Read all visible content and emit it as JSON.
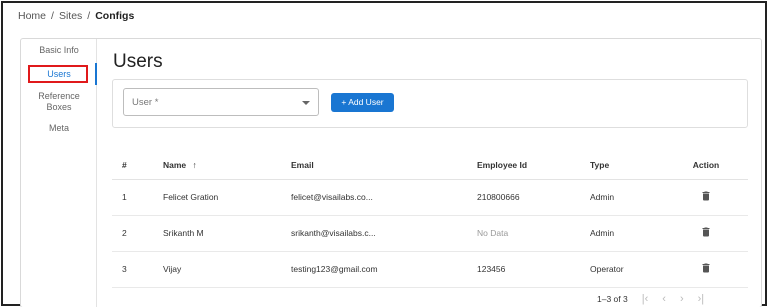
{
  "breadcrumb": {
    "items": [
      "Home",
      "Sites",
      "Configs"
    ],
    "separator": "/"
  },
  "sidebar": {
    "items": [
      {
        "label": "Basic Info"
      },
      {
        "label": "Users",
        "active": true
      },
      {
        "label": "Reference Boxes"
      },
      {
        "label": "Meta"
      }
    ]
  },
  "main": {
    "title": "Users",
    "user_select": {
      "placeholder": "User *"
    },
    "add_user_label": "+ Add User"
  },
  "table": {
    "columns": [
      "#",
      "Name",
      "Email",
      "Employee Id",
      "Type",
      "Action"
    ],
    "sort_indicator": "↑",
    "rows": [
      {
        "num": "1",
        "name": "Felicet Gration",
        "email": "felicet@visailabs.co...",
        "employee_id": "210800666",
        "type": "Admin"
      },
      {
        "num": "2",
        "name": "Srikanth M",
        "email": "srikanth@visailabs.c...",
        "employee_id": "No Data",
        "type": "Admin"
      },
      {
        "num": "3",
        "name": "Vijay",
        "email": "testing123@gmail.com",
        "employee_id": "123456",
        "type": "Operator"
      }
    ]
  },
  "pagination": {
    "range_label": "1–3 of 3"
  },
  "colors": {
    "accent": "#1976d2",
    "highlight": "#e0191b"
  },
  "icons": {
    "delete": "trash-icon",
    "first": "first-page-icon",
    "prev": "prev-page-icon",
    "next": "next-page-icon",
    "last": "last-page-icon",
    "caret": "chevron-down-icon"
  }
}
